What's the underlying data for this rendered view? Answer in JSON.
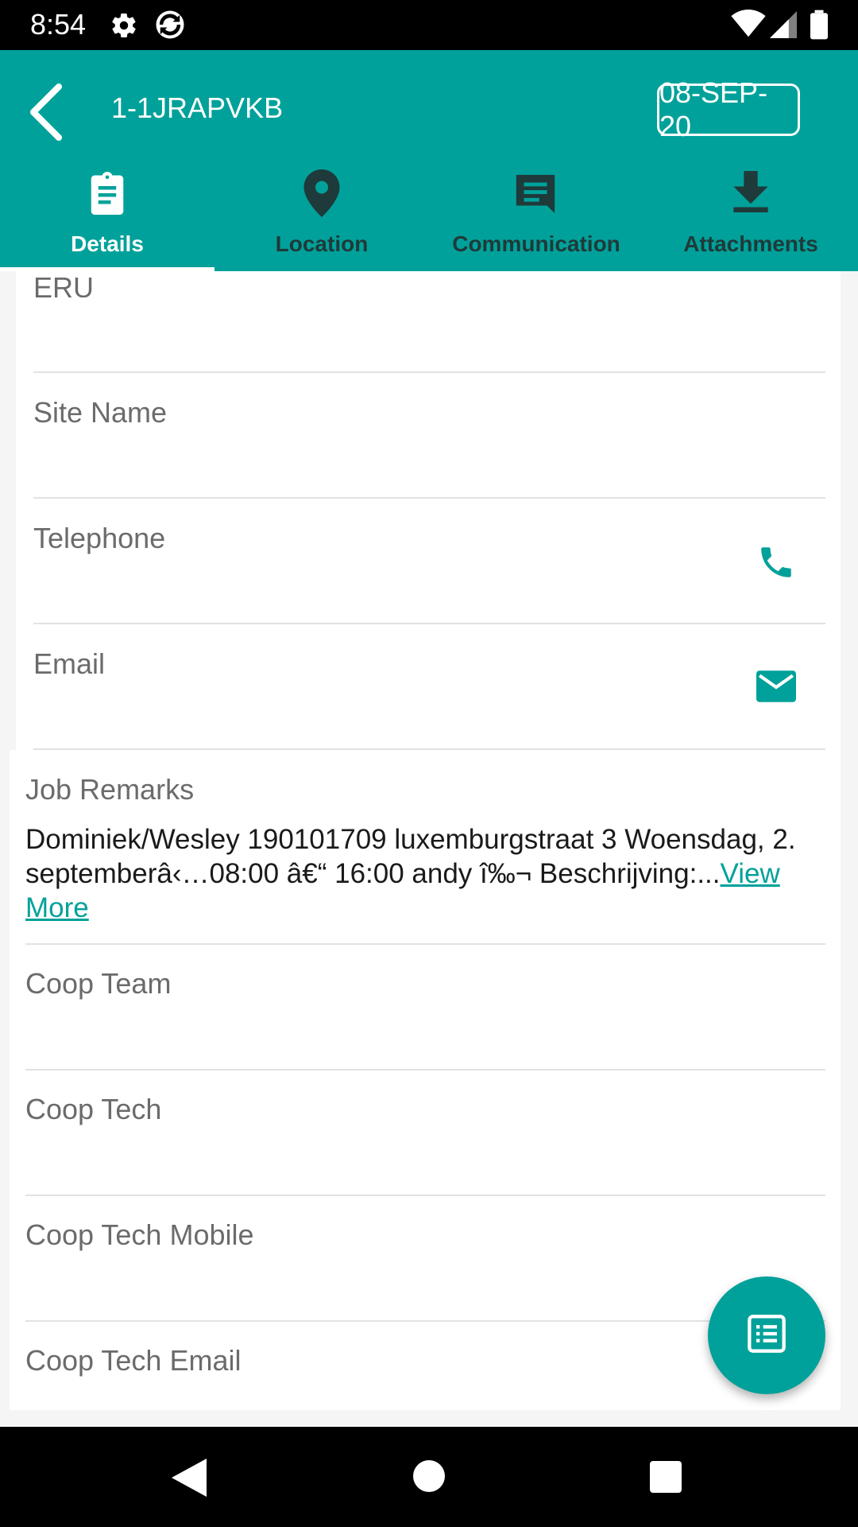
{
  "status_bar": {
    "time": "8:54"
  },
  "header": {
    "job_id": "1-1JRAPVKB",
    "date": "08-SEP-20"
  },
  "tabs": [
    {
      "label": "Details",
      "icon": "clipboard-icon",
      "active": true
    },
    {
      "label": "Location",
      "icon": "location-pin-icon",
      "active": false
    },
    {
      "label": "Communication",
      "icon": "message-icon",
      "active": false
    },
    {
      "label": "Attachments",
      "icon": "download-icon",
      "active": false
    }
  ],
  "fields": {
    "eru": {
      "label": "ERU"
    },
    "site_name": {
      "label": "Site Name"
    },
    "telephone": {
      "label": "Telephone",
      "icon": "phone-icon"
    },
    "email": {
      "label": "Email",
      "icon": "mail-icon"
    },
    "job_remarks": {
      "label": "Job Remarks",
      "text": " Dominiek/Wesley 190101709 luxemburgstraat 3 Woensdag, 2. septemberâ‹…08:00 â€“ 16:00 andy î‰¬ Beschrijving:...",
      "view_more": "View More"
    },
    "coop_team": {
      "label": "Coop Team"
    },
    "coop_tech": {
      "label": "Coop Tech"
    },
    "coop_tech_mobile": {
      "label": "Coop Tech Mobile"
    },
    "coop_tech_email": {
      "label": "Coop Tech Email"
    }
  },
  "fab": {
    "icon": "list-icon"
  },
  "colors": {
    "primary": "#00a19a",
    "tab_inactive": "#1f3a3a"
  }
}
